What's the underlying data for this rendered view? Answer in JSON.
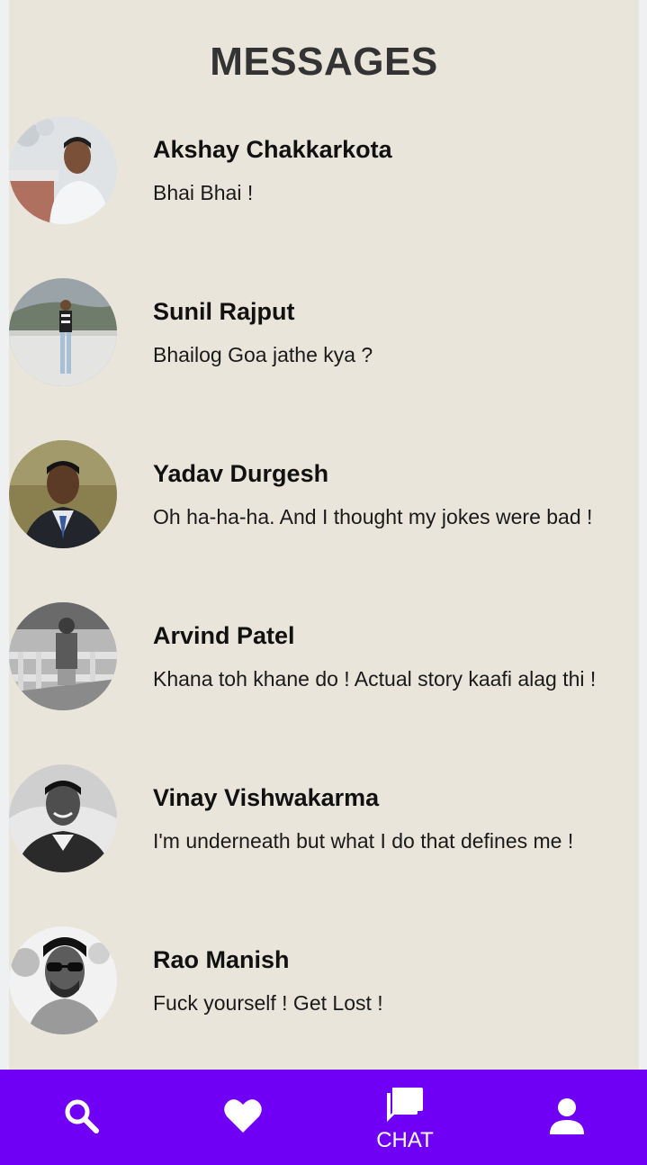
{
  "header": {
    "title": "MESSAGES"
  },
  "messages": [
    {
      "name": "Akshay Chakkarkota",
      "text": "Bhai Bhai !"
    },
    {
      "name": "Sunil Rajput",
      "text": "Bhailog Goa jathe kya ?"
    },
    {
      "name": "Yadav Durgesh",
      "text": "Oh ha-ha-ha. And I thought my jokes were bad !"
    },
    {
      "name": "Arvind Patel",
      "text": "Khana toh khane do ! Actual story kaafi alag thi !"
    },
    {
      "name": "Vinay Vishwakarma",
      "text": "I'm underneath but what I do that defines me !"
    },
    {
      "name": "Rao Manish",
      "text": "Fuck yourself ! Get Lost !"
    }
  ],
  "bottom_nav": {
    "items": [
      {
        "icon": "search-icon"
      },
      {
        "icon": "heart-icon"
      },
      {
        "icon": "chat-icon",
        "label": "CHAT",
        "active": true
      },
      {
        "icon": "profile-icon"
      }
    ]
  },
  "colors": {
    "nav_background": "#7000f5",
    "panel_background": "#e9e5da"
  }
}
